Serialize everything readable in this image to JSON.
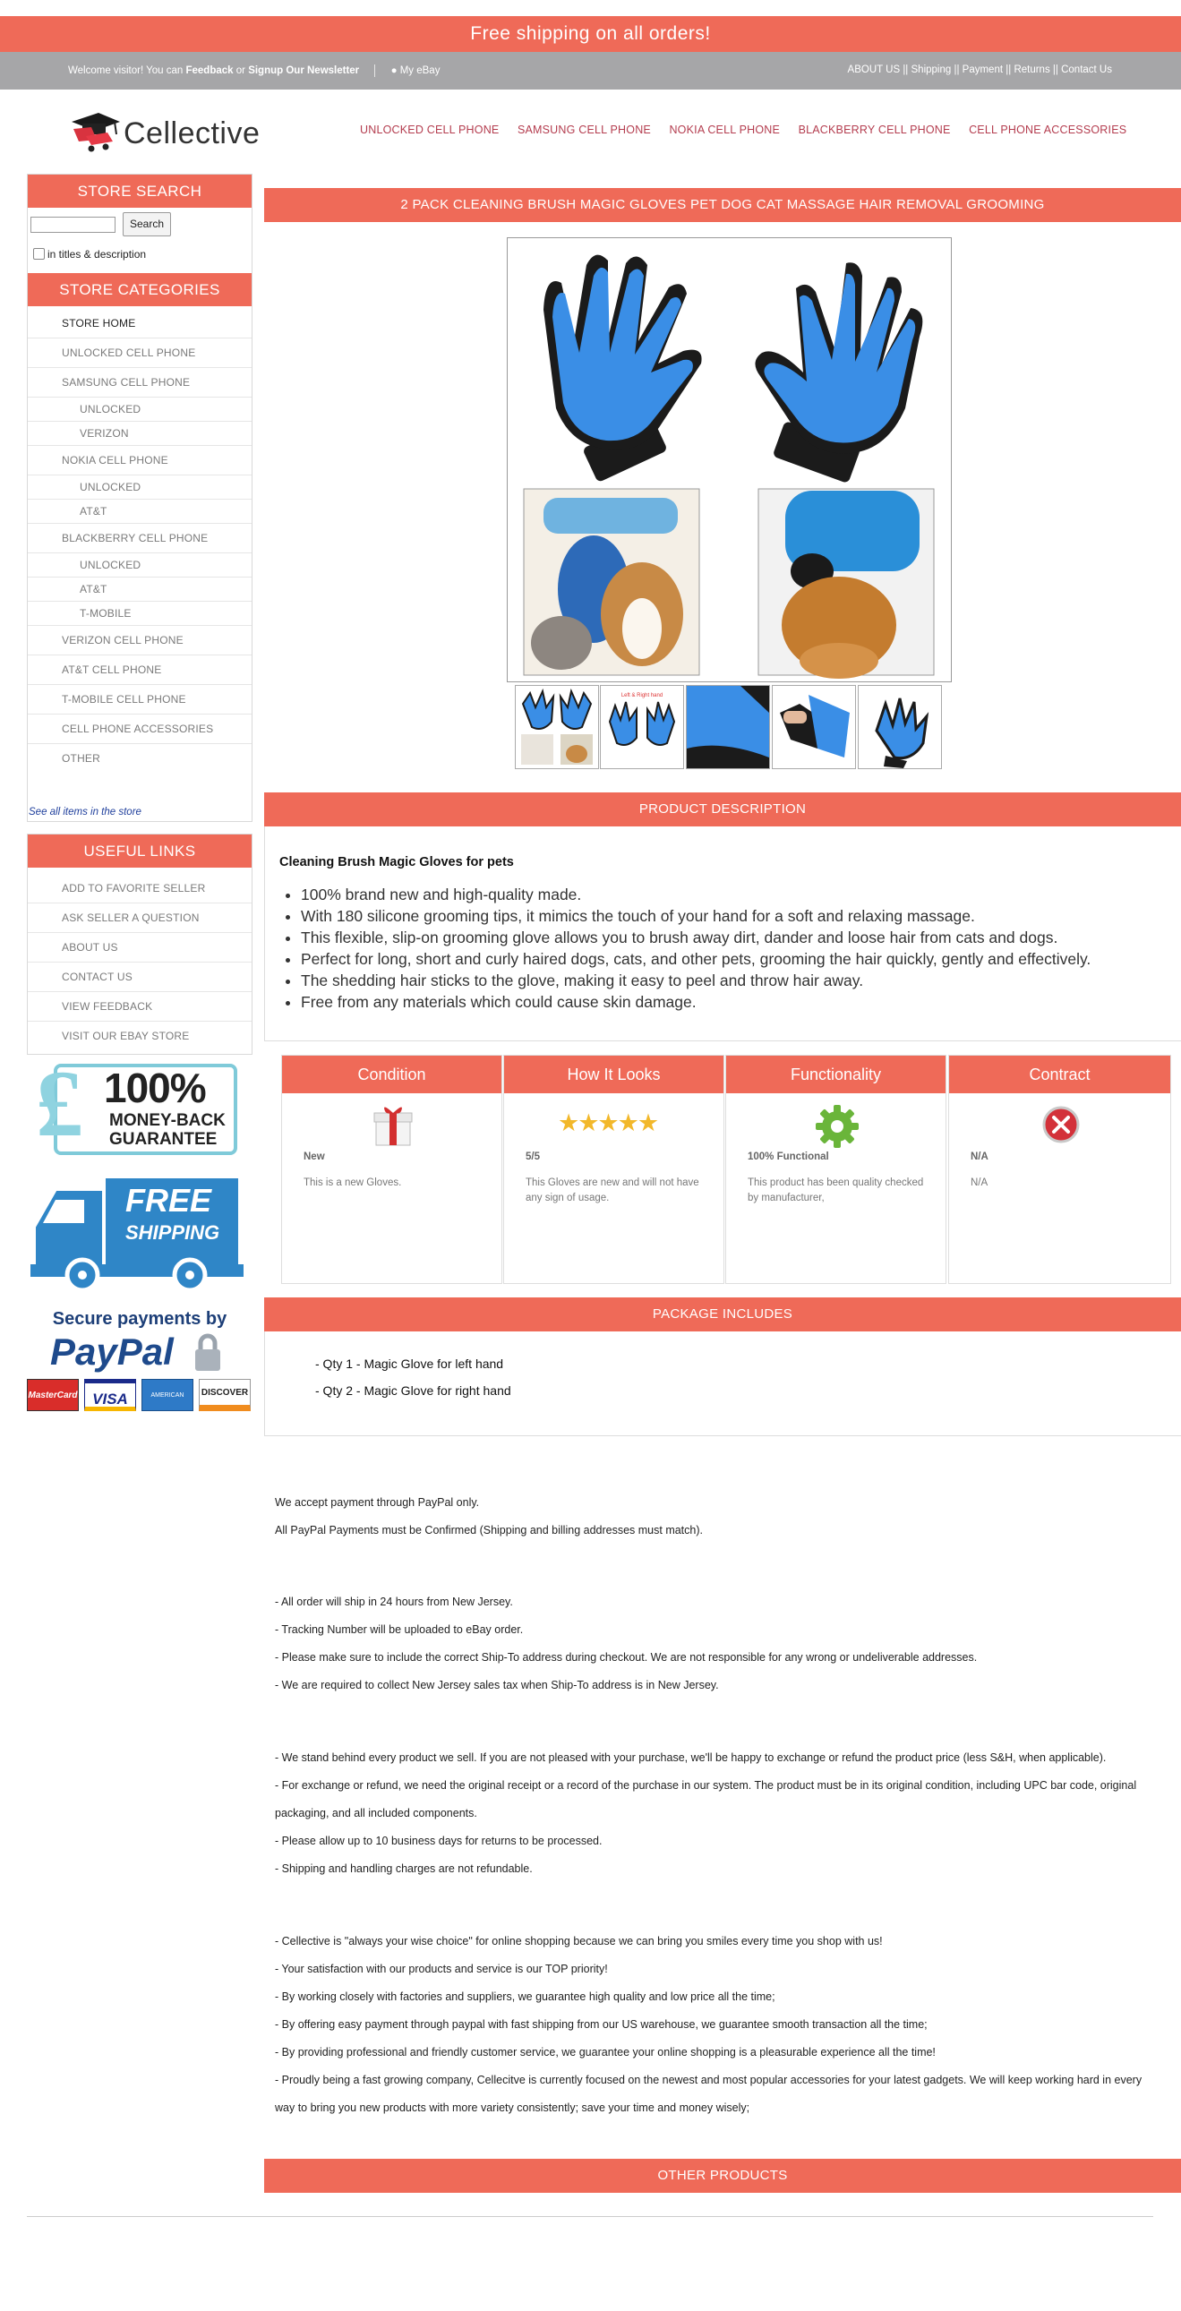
{
  "banner": {
    "text": "Free shipping on all orders!"
  },
  "welcome": {
    "prefix": "Welcome visitor! You can",
    "feedback": "Feedback",
    "or": "or",
    "signup": "Signup Our Newsletter",
    "my_ebay": "My eBay",
    "links": [
      "ABOUT US",
      "||",
      "Shipping",
      "||",
      "Payment",
      "||",
      "Returns",
      "||",
      "Contact Us"
    ]
  },
  "logo": {
    "text": "Cellective"
  },
  "nav": [
    "UNLOCKED CELL PHONE",
    "SAMSUNG CELL PHONE",
    "NOKIA CELL PHONE",
    "BLACKBERRY CELL PHONE",
    "CELL PHONE ACCESSORIES"
  ],
  "store_search": {
    "title": "STORE SEARCH",
    "button": "Search",
    "placeholder": "",
    "checkbox_label": "in titles & description"
  },
  "categories": {
    "title": "STORE CATEGORIES",
    "items": [
      {
        "label": "STORE HOME",
        "level": 0
      },
      {
        "label": "UNLOCKED CELL PHONE",
        "level": 0
      },
      {
        "label": "SAMSUNG CELL PHONE",
        "level": 0
      },
      {
        "label": "UNLOCKED",
        "level": 1
      },
      {
        "label": "VERIZON",
        "level": 1
      },
      {
        "label": "NOKIA CELL PHONE",
        "level": 0
      },
      {
        "label": "UNLOCKED",
        "level": 1
      },
      {
        "label": "AT&T",
        "level": 1
      },
      {
        "label": "BLACKBERRY CELL PHONE",
        "level": 0
      },
      {
        "label": "UNLOCKED",
        "level": 1
      },
      {
        "label": "AT&T",
        "level": 1
      },
      {
        "label": "T-MOBILE",
        "level": 1
      },
      {
        "label": "VERIZON CELL PHONE",
        "level": 0
      },
      {
        "label": "AT&T CELL PHONE",
        "level": 0
      },
      {
        "label": "T-MOBILE CELL PHONE",
        "level": 0
      },
      {
        "label": "CELL PHONE ACCESSORIES",
        "level": 0
      },
      {
        "label": "OTHER",
        "level": 0
      }
    ],
    "see_all": "See all items in the store"
  },
  "useful_links": {
    "title": "USEFUL LINKS",
    "items": [
      "ADD TO FAVORITE SELLER",
      "ASK SELLER A QUESTION",
      "ABOUT US",
      "CONTACT US",
      "VIEW FEEDBACK",
      "VISIT OUR EBAY STORE"
    ]
  },
  "badges": {
    "pound": "£",
    "guarantee_big": "100%",
    "guarantee_line1": "MONEY-BACK",
    "guarantee_line2": "GUARANTEE",
    "free_line1": "FREE",
    "free_line2": "SHIPPING",
    "secure": "Secure payments by",
    "paypal": "PayPal",
    "cards": [
      "MasterCard",
      "VISA",
      "AMERICAN EXPRESS",
      "DISCOVER"
    ]
  },
  "product": {
    "title": "2 PACK CLEANING BRUSH MAGIC GLOVES PET DOG CAT MASSAGE HAIR REMOVAL GROOMING",
    "thumb_caption": "Left & Right hand"
  },
  "description": {
    "head": "PRODUCT DESCRIPTION",
    "subtitle": "Cleaning Brush Magic Gloves for pets",
    "bullets": [
      "100% brand new and high-quality made.",
      "With 180 silicone grooming tips, it mimics the touch of your hand for a soft and relaxing massage.",
      "This flexible, slip-on grooming glove allows you to brush away dirt, dander and loose hair from cats and dogs.",
      "Perfect for long, short and curly haired dogs, cats, and other pets, grooming the hair quickly, gently and effectively.",
      "The shedding hair sticks to the glove, making it easy to peel and throw hair away.",
      "Free from any materials which could cause skin damage."
    ]
  },
  "features": [
    {
      "head": "Condition",
      "title": "New",
      "text": "This is a new Gloves.",
      "icon": "gift-icon"
    },
    {
      "head": "How It Looks",
      "title": "5/5",
      "text": "This Gloves are new and will not have any sign of usage.",
      "icon": "five-stars-icon"
    },
    {
      "head": "Functionality",
      "title": "100% Functional",
      "text": "This product has been quality checked by manufacturer,",
      "icon": "gear-icon"
    },
    {
      "head": "Contract",
      "title": "N/A",
      "text": "N/A",
      "icon": "close-icon"
    }
  ],
  "package": {
    "head": "PACKAGE INCLUDES",
    "items": [
      "- Qty 1 - Magic Glove for left hand",
      "- Qty 2 - Magic Glove for right hand"
    ]
  },
  "policies": {
    "payment": [
      "We accept payment through PayPal only.",
      "All PayPal Payments must be Confirmed (Shipping and billing addresses must match)."
    ],
    "shipping": [
      "- All order will ship in 24 hours from New Jersey.",
      "- Tracking Number will be uploaded to eBay order.",
      "- Please make sure to include the correct Ship-To address during checkout. We are not responsible for any wrong or undeliverable addresses.",
      "- We are required to collect New Jersey sales tax when Ship-To address is in New Jersey."
    ],
    "returns": [
      "- We stand behind every product we sell. If you are not pleased with your purchase, we'll be happy to exchange or refund the product price (less S&H, when applicable).",
      "- For exchange or refund, we need the original receipt or a record of the purchase in our system. The product must be in its original condition, including UPC bar code, original",
      "packaging, and all included components.",
      "- Please allow up to 10 business days for returns to be processed.",
      "- Shipping and handling charges are not refundable."
    ],
    "about": [
      "- Cellective is \"always your wise choice\" for online shopping because we can bring you smiles every time you shop with us!",
      "- Your satisfaction with our products and service is our TOP priority!",
      "- By working closely with factories and suppliers, we guarantee high quality and low price all the time;",
      "- By offering easy payment through paypal with fast shipping from our US warehouse, we guarantee smooth transaction all the time;",
      "- By providing professional and friendly customer service, we guarantee your online shopping is a pleasurable experience all the time!",
      "- Proudly being a fast growing company, Cellecitve is currently focused on the newest and most popular accessories for your latest gadgets. We will keep working hard in every",
      "way to bring you new products with more variety consistently; save your time and money wisely;"
    ]
  },
  "other_products": {
    "head": "OTHER PRODUCTS"
  },
  "colors": {
    "accent": "#ef6a58",
    "glove_blue": "#3a8ee6",
    "nav_link": "#b43d4f",
    "grey_bar": "#a6a6a8"
  }
}
